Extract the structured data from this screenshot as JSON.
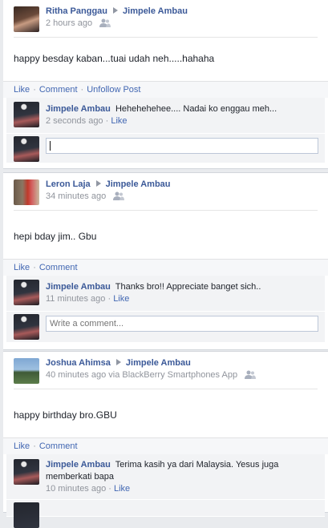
{
  "posts": [
    {
      "author": "Ritha Panggau",
      "target": "Jimpele Ambau",
      "time": "2 hours ago",
      "text": "happy besday kaban...tuai udah neh.....hahaha",
      "actions": [
        "Like",
        "Comment",
        "Unfollow Post"
      ],
      "comments": [
        {
          "author": "Jimpele Ambau",
          "text": "Hehehehehee.... Nadai ko enggau meh...",
          "time": "2 seconds ago",
          "like": "Like"
        }
      ],
      "write_value": ""
    },
    {
      "author": "Leron Laja",
      "target": "Jimpele Ambau",
      "time": "34 minutes ago",
      "text": "hepi bday jim.. Gbu",
      "actions": [
        "Like",
        "Comment"
      ],
      "comments": [
        {
          "author": "Jimpele Ambau",
          "text": "Thanks bro!! Appreciate banget sich..",
          "time": "11 minutes ago",
          "like": "Like"
        }
      ],
      "write_placeholder": "Write a comment..."
    },
    {
      "author": "Joshua Ahimsa",
      "target": "Jimpele Ambau",
      "time": "40 minutes ago via BlackBerry Smartphones App",
      "text": "happy birthday bro.GBU",
      "actions": [
        "Like",
        "Comment"
      ],
      "comments": [
        {
          "author": "Jimpele Ambau",
          "text": "Terima kasih ya dari Malaysia. Yesus juga memberkati bapa",
          "time": "10 minutes ago",
          "like": "Like"
        }
      ]
    }
  ],
  "colors": {
    "link": "#3b5998",
    "action": "#4267b2",
    "meta": "#90949c"
  },
  "icons": {
    "audience": "friends-audience-icon",
    "arrow": "triangle-right-icon"
  }
}
